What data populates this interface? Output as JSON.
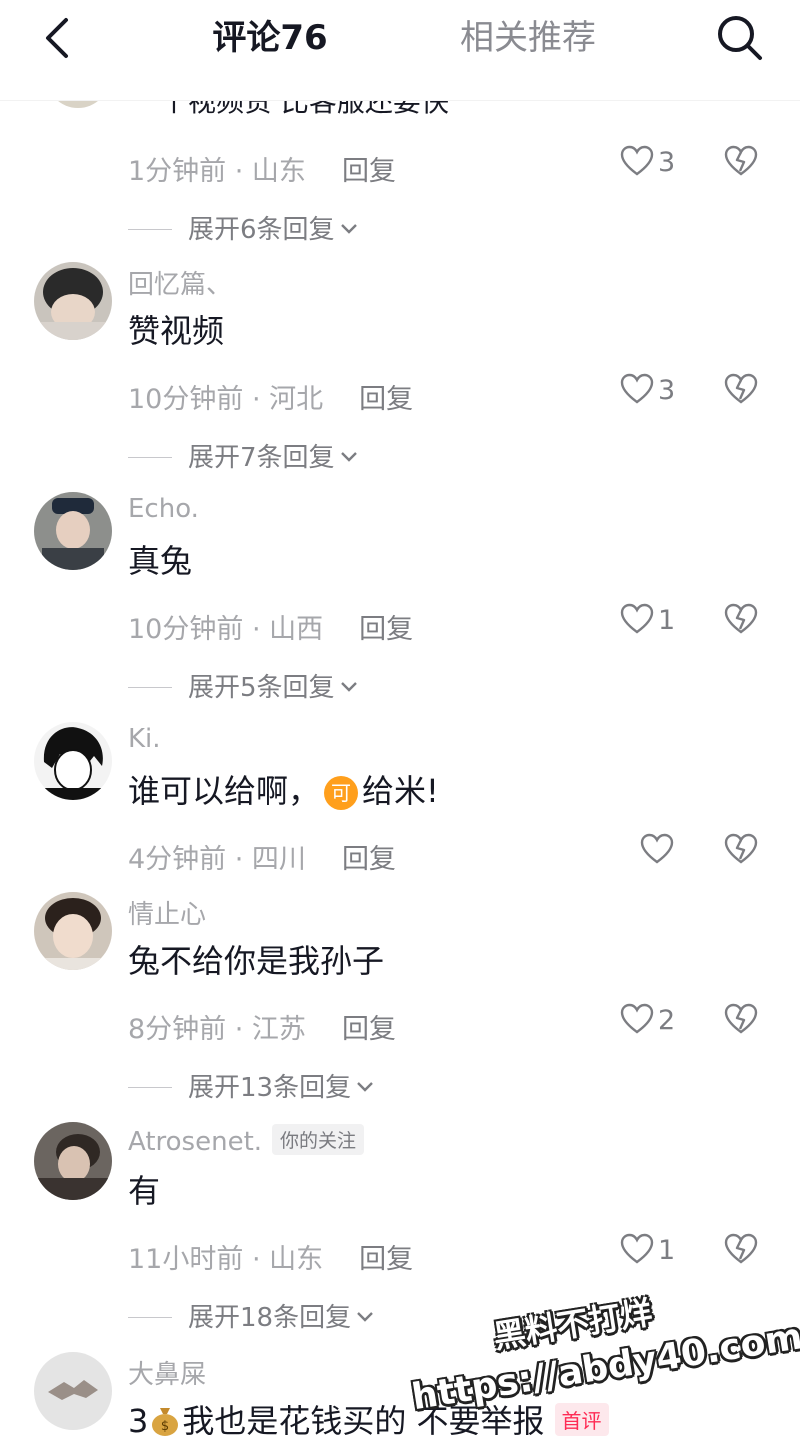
{
  "header": {
    "tab_comments": "评论76",
    "tab_related": "相关推荐"
  },
  "partial_comment": {
    "text": "个视频贵 比客服还要快"
  },
  "comments": [
    {
      "meta_time": "1分钟前 · 山东",
      "reply_label": "回复",
      "likes": "3",
      "expand_label": "展开6条回复"
    },
    {
      "username": "回忆篇、",
      "text": "赞视频",
      "meta_time": "10分钟前 · 河北",
      "reply_label": "回复",
      "likes": "3",
      "expand_label": "展开7条回复"
    },
    {
      "username": "Echo.",
      "text": "真兔",
      "meta_time": "10分钟前 · 山西",
      "reply_label": "回复",
      "likes": "1",
      "expand_label": "展开5条回复"
    },
    {
      "username": "Ki.",
      "text_before": "谁可以给啊，",
      "emoji_char": "可",
      "text_after": "给米!",
      "meta_time": "4分钟前 · 四川",
      "reply_label": "回复",
      "likes": ""
    },
    {
      "username": "情止心",
      "text": "兔不给你是我孙子",
      "meta_time": "8分钟前 · 江苏",
      "reply_label": "回复",
      "likes": "2",
      "expand_label": "展开13条回复"
    },
    {
      "username": "Atrosenet.",
      "badge": "你的关注",
      "text": "有",
      "meta_time": "11小时前 · 山东",
      "reply_label": "回复",
      "likes": "1",
      "expand_label": "展开18条回复"
    },
    {
      "username": "大鼻屎",
      "text_before": "3",
      "text_after": "我也是花钱买的 不要举报",
      "badge": "首评"
    }
  ],
  "watermark": {
    "line1": "黑料不打烊",
    "line2": "https://abdy40.com"
  },
  "colors": {
    "primary_text": "#161823",
    "secondary_text": "#a6a7ab",
    "accent_red": "#fe2c55"
  }
}
